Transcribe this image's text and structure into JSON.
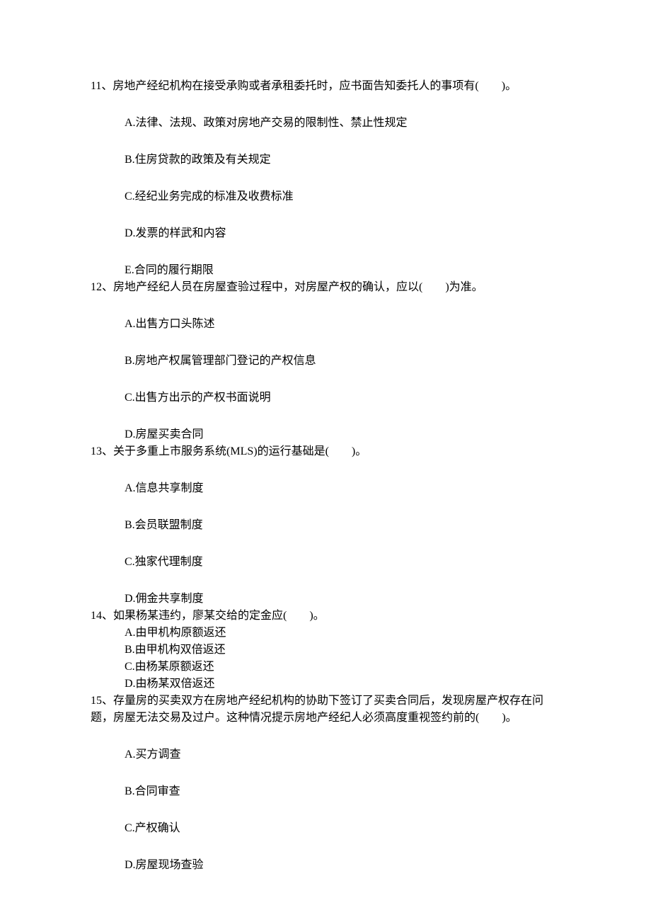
{
  "q11": {
    "num": "11、",
    "stem": "房地产经纪机构在接受承购或者承租委托时，应书面告知委托人的事项有(　　)。",
    "opts": {
      "A": "A.法律、法规、政策对房地产交易的限制性、禁止性规定",
      "B": "B.住房贷款的政策及有关规定",
      "C": "C.经纪业务完成的标准及收费标准",
      "D": "D.发票的样武和内容",
      "E": "E.合同的履行期限"
    }
  },
  "q12": {
    "num": "12、",
    "stem": "房地产经纪人员在房屋查验过程中，对房屋产权的确认，应以(　　)为准。",
    "opts": {
      "A": "A.出售方口头陈述",
      "B": "B.房地产权属管理部门登记的产权信息",
      "C": "C.出售方出示的产权书面说明",
      "D": "D.房屋买卖合同"
    }
  },
  "q13": {
    "num": "13、",
    "stem": "关于多重上市服务系统(MLS)的运行基础是(　　)。",
    "opts": {
      "A": "A.信息共享制度",
      "B": "B.会员联盟制度",
      "C": "C.独家代理制度",
      "D": "D.佣金共享制度"
    }
  },
  "q14": {
    "num": "14、",
    "stem": "如果杨某违约，廖某交给的定金应(　　)。",
    "opts": {
      "A": "A.由甲机构原额返还",
      "B": "B.由甲机构双倍返还",
      "C": "C.由杨某原额返还",
      "D": "D.由杨某双倍返还"
    }
  },
  "q15": {
    "num": "15、",
    "stem1": "存量房的买卖双方在房地产经纪机构的协助下签订了买卖合同后，发现房屋产权存在问",
    "stem2": "题，房屋无法交易及过户。这种情况提示房地产经纪人必须高度重视签约前的(　　)。",
    "opts": {
      "A": "A.买方调查",
      "B": "B.合同审查",
      "C": "C.产权确认",
      "D": "D.房屋现场查验"
    }
  }
}
